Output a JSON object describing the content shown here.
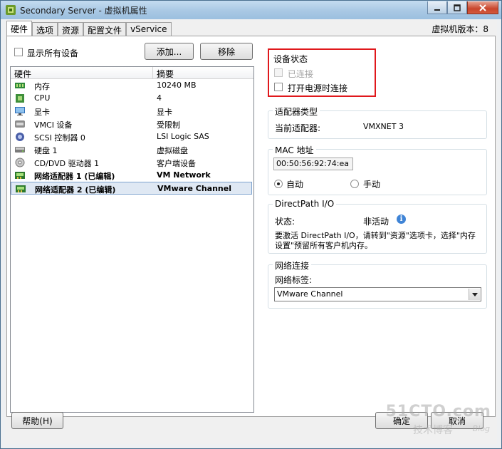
{
  "window": {
    "title": "Secondary Server - 虚拟机属性",
    "vm_version": "虚拟机版本：8"
  },
  "tabs": [
    {
      "label": "硬件",
      "active": true
    },
    {
      "label": "选项",
      "active": false
    },
    {
      "label": "资源",
      "active": false
    },
    {
      "label": "配置文件",
      "active": false
    },
    {
      "label": "vService",
      "active": false
    }
  ],
  "hardware": {
    "show_all_label": "显示所有设备",
    "add_label": "添加...",
    "remove_label": "移除",
    "col_hardware": "硬件",
    "col_summary": "摘要",
    "rows": [
      {
        "name": "内存",
        "summary": "10240 MB",
        "icon": "memory-icon"
      },
      {
        "name": "CPU",
        "summary": "4",
        "icon": "cpu-icon"
      },
      {
        "name": "显卡",
        "summary": "显卡",
        "icon": "display-icon"
      },
      {
        "name": "VMCI 设备",
        "summary": "受限制",
        "icon": "vmci-icon"
      },
      {
        "name": "SCSI 控制器 0",
        "summary": "LSI Logic SAS",
        "icon": "scsi-icon"
      },
      {
        "name": "硬盘 1",
        "summary": "虚拟磁盘",
        "icon": "disk-icon"
      },
      {
        "name": "CD/DVD 驱动器 1",
        "summary": "客户端设备",
        "icon": "cd-icon"
      },
      {
        "name": "网络适配器 1 (已编辑)",
        "summary": "VM Network",
        "icon": "network-icon"
      },
      {
        "name": "网络适配器 2 (已编辑)",
        "summary": "VMware Channel",
        "icon": "network-icon"
      }
    ]
  },
  "device_status": {
    "title": "设备状态",
    "connected_label": "已连接",
    "connect_at_power_on_label": "打开电源时连接"
  },
  "adapter_type": {
    "title": "适配器类型",
    "current_label": "当前适配器:",
    "current_value": "VMXNET 3"
  },
  "mac": {
    "title": "MAC 地址",
    "value": "00:50:56:92:74:ea",
    "auto_label": "自动",
    "manual_label": "手动"
  },
  "directpath": {
    "title": "DirectPath I/O",
    "status_label": "状态:",
    "status_value": "非活动",
    "note": "要激活 DirectPath I/O，请转到\"资源\"选项卡，选择\"内存设置\"预留所有客户机内存。"
  },
  "network": {
    "title": "网络连接",
    "label_caption": "网络标签:",
    "selected": "VMware Channel"
  },
  "footer": {
    "help_label": "帮助(H)",
    "ok_label": "确定",
    "cancel_label": "取消"
  },
  "watermark": {
    "line1": "51CTO.com",
    "line2": "技术博客",
    "line3": "Blog"
  }
}
